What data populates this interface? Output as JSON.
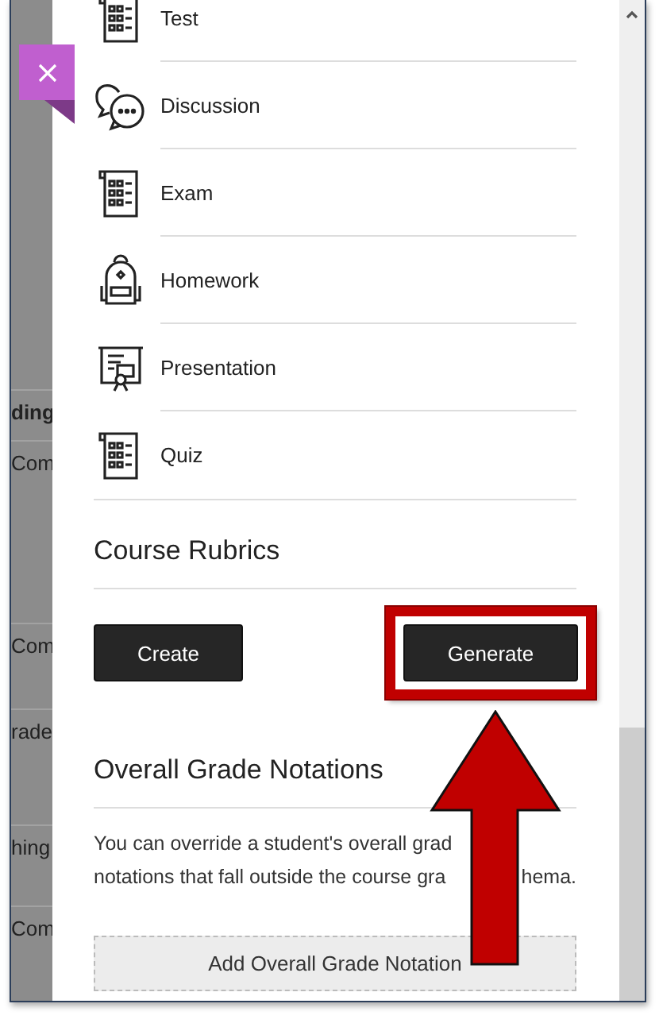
{
  "background_rows": [
    {
      "text": "ding",
      "bold": true
    },
    {
      "text": "Com",
      "bold": false
    },
    {
      "text": "Com",
      "bold": false
    },
    {
      "text": "rade",
      "bold": false
    },
    {
      "text": "hing",
      "bold": false
    },
    {
      "text": "Com",
      "bold": false
    }
  ],
  "item_types": [
    {
      "label": "Test",
      "kind": "sheet"
    },
    {
      "label": "Discussion",
      "kind": "bubbles"
    },
    {
      "label": "Exam",
      "kind": "sheet"
    },
    {
      "label": "Homework",
      "kind": "backpack"
    },
    {
      "label": "Presentation",
      "kind": "board"
    },
    {
      "label": "Quiz",
      "kind": "sheet"
    }
  ],
  "rubrics": {
    "heading": "Course Rubrics",
    "buttons": [
      {
        "label": "Create",
        "highlighted": false
      },
      {
        "label": "Generate",
        "highlighted": true
      }
    ]
  },
  "notations": {
    "heading": "Overall Grade Notations",
    "lines": [
      [
        "You can override a student's overall grad"
      ],
      [
        "notations that fall outside the course gra",
        "hema."
      ]
    ],
    "add_button": "Add Overall Grade Notation"
  }
}
